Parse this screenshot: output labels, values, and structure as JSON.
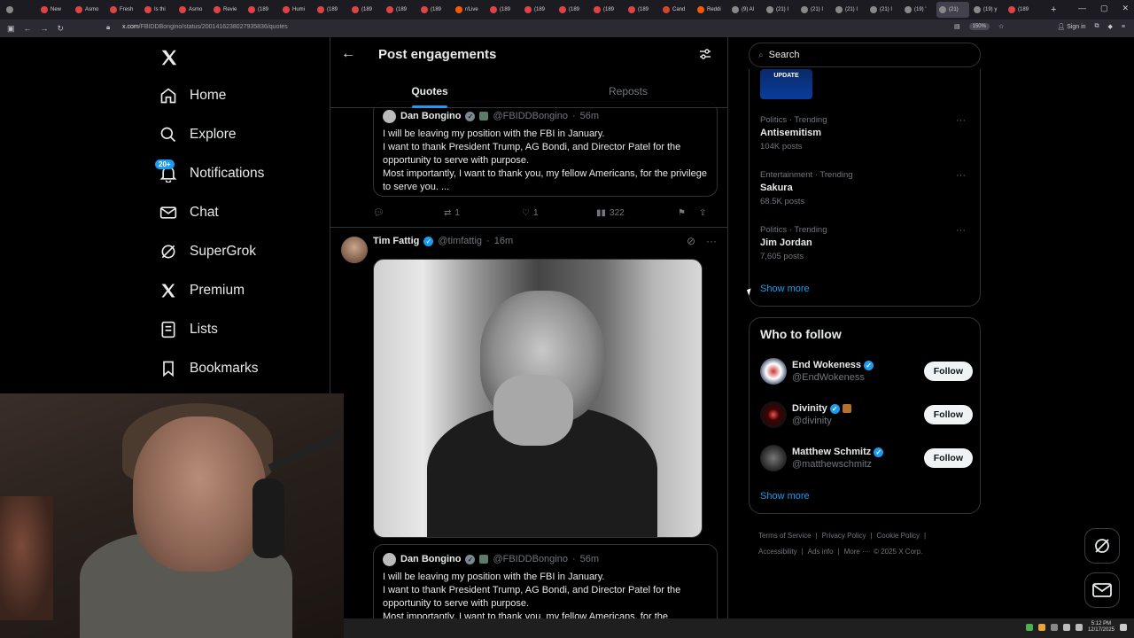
{
  "browser": {
    "tabs": [
      {
        "label": "",
        "color": "#888888"
      },
      {
        "label": "New",
        "color": "#e04343"
      },
      {
        "label": "Asmo",
        "color": "#e04343"
      },
      {
        "label": "Fresh",
        "color": "#e04343"
      },
      {
        "label": "Is thi",
        "color": "#e04343"
      },
      {
        "label": "Asmo",
        "color": "#e04343"
      },
      {
        "label": "Revie",
        "color": "#e04343"
      },
      {
        "label": "(189",
        "color": "#e04343"
      },
      {
        "label": "Humi",
        "color": "#e04343"
      },
      {
        "label": "(189",
        "color": "#e04343"
      },
      {
        "label": "(189",
        "color": "#e04343"
      },
      {
        "label": "(189",
        "color": "#e04343"
      },
      {
        "label": "(189",
        "color": "#e04343"
      },
      {
        "label": "r/Live",
        "color": "#ff5700"
      },
      {
        "label": "(189",
        "color": "#e04343"
      },
      {
        "label": "(189",
        "color": "#e04343"
      },
      {
        "label": "(189",
        "color": "#e04343"
      },
      {
        "label": "(189",
        "color": "#e04343"
      },
      {
        "label": "(189",
        "color": "#e04343"
      },
      {
        "label": "Cand",
        "color": "#d8452c"
      },
      {
        "label": "Reddi",
        "color": "#ff5700"
      },
      {
        "label": "(9) Al",
        "color": "#888888"
      },
      {
        "label": "(21) I",
        "color": "#888888"
      },
      {
        "label": "(21) I",
        "color": "#888888"
      },
      {
        "label": "(21) I",
        "color": "#888888"
      },
      {
        "label": "(21) I",
        "color": "#888888"
      },
      {
        "label": "(19) '",
        "color": "#888888"
      },
      {
        "label": "(21)",
        "color": "#888888",
        "active": true
      },
      {
        "label": "(19) y",
        "color": "#888888"
      },
      {
        "label": "(189",
        "color": "#e04343"
      }
    ],
    "url_host": "x.com",
    "url_path": "/FBIDDBongino/status/2001416238027935836/quotes",
    "zoom": "150%",
    "signin": "Sign in"
  },
  "nav": {
    "items": [
      {
        "label": "Home",
        "icon": "home-icon"
      },
      {
        "label": "Explore",
        "icon": "search-icon"
      },
      {
        "label": "Notifications",
        "icon": "bell-icon",
        "badge": "20+"
      },
      {
        "label": "Chat",
        "icon": "mail-icon"
      },
      {
        "label": "SuperGrok",
        "icon": "grok-icon"
      },
      {
        "label": "Premium",
        "icon": "x-icon"
      },
      {
        "label": "Lists",
        "icon": "list-icon"
      },
      {
        "label": "Bookmarks",
        "icon": "bookmark-icon"
      }
    ]
  },
  "header": {
    "title": "Post engagements",
    "tabs": [
      "Quotes",
      "Reposts"
    ]
  },
  "quoted": {
    "name": "Dan Bongino",
    "handle": "@FBIDDBongino",
    "time": "56m",
    "lines": [
      "I will be leaving my position with the FBI in January.",
      "I want to thank President Trump, AG Bondi, and Director Patel for the opportunity to serve with purpose.",
      "Most importantly, I want to thank you, my fellow Americans, for the privilege to serve you. ..."
    ],
    "truncated_line": "Most importantly, I want to thank you, my fellow Americans, for the"
  },
  "actions": {
    "replies": "",
    "reposts": "1",
    "likes": "1",
    "views": "322"
  },
  "post2": {
    "name": "Tim Fattig",
    "handle": "@timfattig",
    "time": "16m"
  },
  "right": {
    "search_placeholder": "Search",
    "update_thumb": "UPDATE",
    "trends": [
      {
        "category": "Politics · Trending",
        "name": "Antisemitism",
        "count": "104K posts"
      },
      {
        "category": "Entertainment · Trending",
        "name": "Sakura",
        "count": "68.5K posts"
      },
      {
        "category": "Politics · Trending",
        "name": "Jim Jordan",
        "count": "7,605 posts"
      }
    ],
    "show_more": "Show more",
    "who_to_follow": "Who to follow",
    "follow": [
      {
        "name": "End Wokeness",
        "handle": "@EndWokeness"
      },
      {
        "name": "Divinity",
        "handle": "@divinity"
      },
      {
        "name": "Matthew Schmitz",
        "handle": "@matthewschmitz"
      }
    ],
    "follow_label": "Follow",
    "show_more_2": "Show more",
    "footer": [
      "Terms of Service",
      "|",
      "Privacy Policy",
      "|",
      "Cookie Policy",
      "|",
      "Accessibility",
      "|",
      "Ads info",
      "|",
      "More ···",
      "© 2025 X Corp."
    ]
  },
  "taskbar": {
    "time": "5:12 PM",
    "date": "12/17/2025"
  },
  "colors": {
    "accent": "#1d9bf0",
    "border": "#2f3336",
    "muted": "#71767b"
  }
}
